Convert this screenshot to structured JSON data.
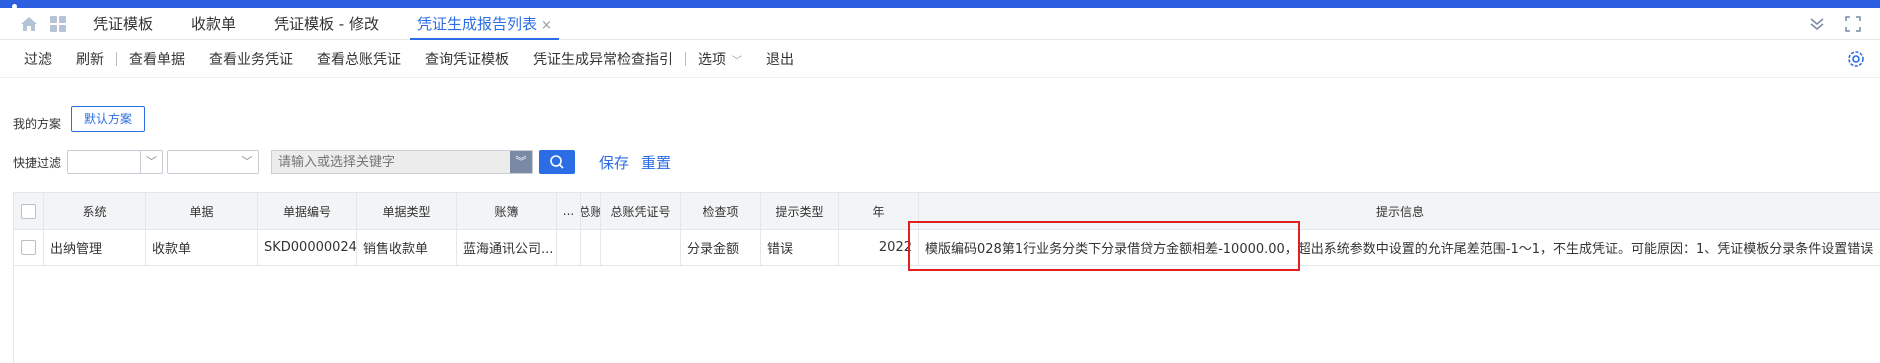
{
  "tabs": [
    {
      "label": "凭证模板"
    },
    {
      "label": "收款单"
    },
    {
      "label": "凭证模板 - 修改"
    },
    {
      "label": "凭证生成报告列表",
      "close": "×"
    }
  ],
  "toolbar": {
    "items": [
      "过滤",
      "刷新",
      "查看单据",
      "查看业务凭证",
      "查看总账凭证",
      "查询凭证模板",
      "凭证生成异常检查指引",
      "选项",
      "退出"
    ]
  },
  "scheme": {
    "label": "我的方案",
    "default_button": "默认方案"
  },
  "quick_filter": {
    "label": "快捷过滤",
    "keyword_placeholder": "请输入或选择关键字",
    "save": "保存",
    "reset": "重置"
  },
  "grid": {
    "columns": [
      "系统",
      "单据",
      "单据编号",
      "单据类型",
      "账簿",
      "...",
      "总账",
      "总账凭证号",
      "检查项",
      "提示类型",
      "年",
      "提示信息"
    ],
    "rows": [
      {
        "system": "出纳管理",
        "bill": "收款单",
        "bill_no": "SKD00000024",
        "bill_type": "销售收款单",
        "book": "蓝海通讯公司...",
        "dots": "",
        "gl": "",
        "gl_voucher": "",
        "check_item": "分录金额",
        "hint_type": "错误",
        "year": "2022",
        "message": "模版编码028第1行业务分类下分录借贷方金额相差-10000.00，超出系统参数中设置的允许尾差范围-1～1，不生成凭证。可能原因：1、凭证模板分录条件设置错误"
      }
    ]
  },
  "colors": {
    "accent": "#2b6de5",
    "highlight_box": "#e02020",
    "top_bar": "#2b5fe0"
  }
}
